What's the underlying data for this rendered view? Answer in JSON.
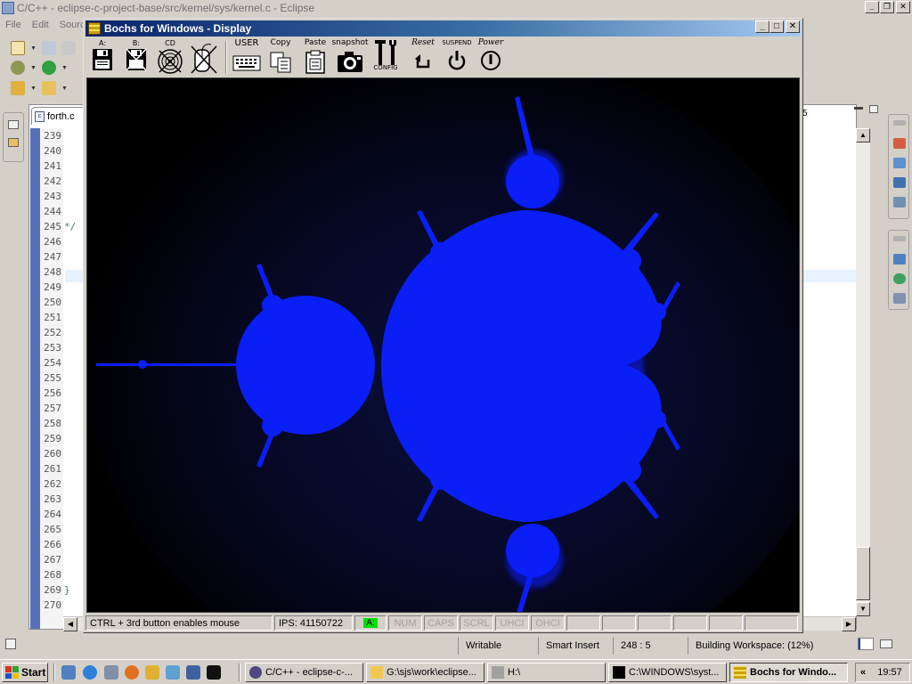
{
  "eclipse": {
    "title": "C/C++ - eclipse-c-project-base/src/kernel/sys/kernel.c - Eclipse",
    "menu": [
      "File",
      "Edit",
      "Source"
    ],
    "editor": {
      "tab_label": "forth.c",
      "right_tab_fragment": "5",
      "line_numbers": [
        "239",
        "240",
        "241",
        "242",
        "243",
        "244",
        "245",
        "246",
        "247",
        "248",
        "249",
        "250",
        "251",
        "252",
        "253",
        "254",
        "255",
        "256",
        "257",
        "258",
        "259",
        "260",
        "261",
        "262",
        "263",
        "264",
        "265",
        "266",
        "267",
        "268",
        "269",
        "270"
      ],
      "code_fragments": {
        "245": "*/",
        "269": "}"
      }
    },
    "status": {
      "writable": "Writable",
      "insert_mode": "Smart Insert",
      "cursor_position": "248 : 5",
      "build_status": "Building Workspace: (12%)",
      "build_progress": 0.12
    }
  },
  "bochs": {
    "title": "Bochs for Windows - Display",
    "toolbar": {
      "floppy_a": "A:",
      "floppy_b": "B:",
      "cdrom": "CD",
      "user": "USER",
      "copy": "Copy",
      "paste": "Paste",
      "snapshot": "snapshot",
      "config": "CONFIG",
      "reset": "Reset",
      "suspend": "SUSPEND",
      "power": "Power"
    },
    "status": {
      "mouse_hint": "CTRL + 3rd button enables mouse",
      "ips": "IPS:  41150722",
      "drive_led": "A:",
      "indicators": [
        "NUM",
        "CAPS",
        "SCRL",
        "UHCI",
        "OHCI"
      ]
    },
    "colors": {
      "fractal": "#0a1ef8",
      "background": "#000000"
    }
  },
  "taskbar": {
    "start": "Start",
    "tasks": [
      {
        "label": "C/C++ - eclipse-c-...",
        "icon": "eclipse-icon"
      },
      {
        "label": "G:\\sjs\\work\\eclipse...",
        "icon": "folder-icon"
      },
      {
        "label": "H:\\",
        "icon": "drive-icon"
      },
      {
        "label": "C:\\WINDOWS\\syst...",
        "icon": "console-icon"
      },
      {
        "label": "Bochs for Windo...",
        "icon": "bochs-icon"
      }
    ],
    "tray_chevron": "«",
    "clock": "19:57"
  }
}
